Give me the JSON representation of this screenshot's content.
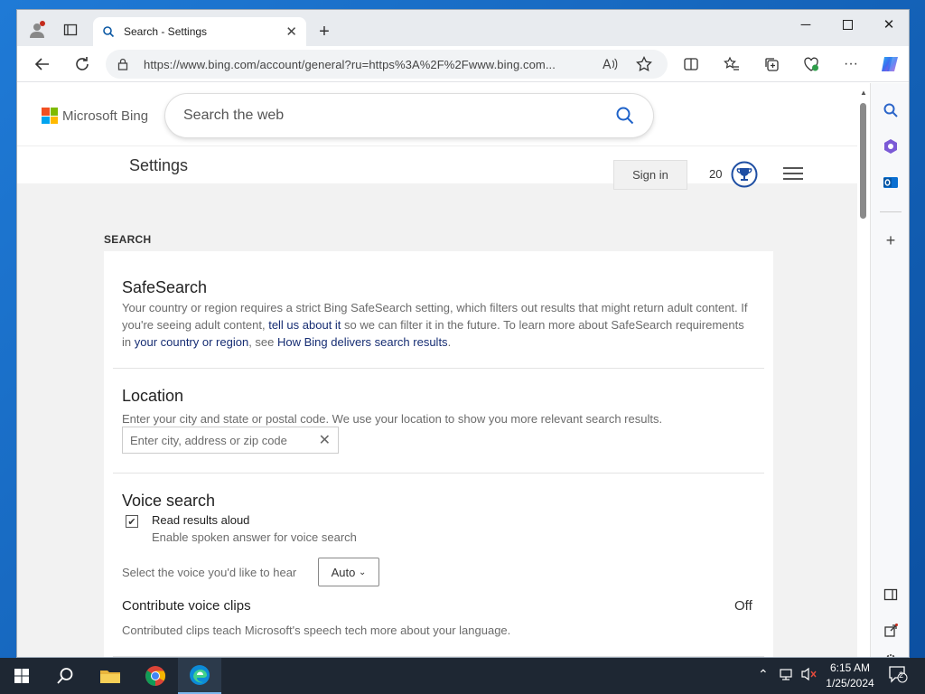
{
  "browser": {
    "tab_title": "Search - Settings",
    "url": "https://www.bing.com/account/general?ru=https%3A%2F%2Fwww.bing.com..."
  },
  "header": {
    "logo_text": "Microsoft Bing",
    "search_placeholder": "Search the web",
    "page_title": "Settings",
    "signin_label": "Sign in",
    "rewards_count": "20"
  },
  "section": {
    "label": "SEARCH"
  },
  "safesearch": {
    "title": "SafeSearch",
    "text_1": "Your country or region requires a strict Bing SafeSearch setting, which filters out results that might return adult content. If you're seeing adult content, ",
    "link_1": "tell us about it",
    "text_2": " so we can filter it in the future. To learn more about SafeSearch requirements in ",
    "link_2": "your country or region",
    "text_3": ", see ",
    "link_3": "How Bing delivers search results",
    "text_4": "."
  },
  "location": {
    "title": "Location",
    "description": "Enter your city and state or postal code. We use your location to show you more relevant search results.",
    "placeholder": "Enter city, address or zip code"
  },
  "voice": {
    "title": "Voice search",
    "read_aloud_label": "Read results aloud",
    "read_aloud_checked": true,
    "read_aloud_sub": "Enable spoken answer for voice search",
    "select_label": "Select the voice you'd like to hear",
    "select_value": "Auto",
    "contrib_title": "Contribute voice clips",
    "contrib_value": "Off",
    "contrib_text": "Contributed clips teach Microsoft's speech tech more about your language."
  },
  "taskbar": {
    "time": "6:15 AM",
    "date": "1/25/2024",
    "notification_count": "2"
  },
  "colors": {
    "link": "#1a0dab",
    "accent_blue": "#0c59a4",
    "taskbar": "#1e2733"
  }
}
